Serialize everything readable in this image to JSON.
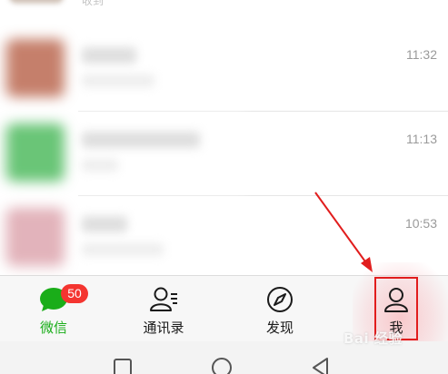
{
  "top_partial": {
    "text": "收到"
  },
  "chats": [
    {
      "time": "11:32",
      "avatar_color": "#b2553a"
    },
    {
      "time": "11:13",
      "avatar_color": "#38b24a"
    },
    {
      "time": "10:53",
      "avatar_color": "#d99aa4"
    }
  ],
  "tabbar": {
    "tabs": [
      {
        "label": "微信",
        "icon": "chat-bubble-icon",
        "badge": "50",
        "active": true
      },
      {
        "label": "通讯录",
        "icon": "contacts-icon",
        "active": false
      },
      {
        "label": "发现",
        "icon": "compass-icon",
        "active": false
      },
      {
        "label": "我",
        "icon": "person-icon",
        "active": false
      }
    ]
  },
  "annotation": {
    "arrow_color": "#e11d1d",
    "box_color": "#e11d1d"
  },
  "navbar": {
    "buttons": [
      "recent-apps-icon",
      "home-icon",
      "back-icon"
    ]
  },
  "watermark": {
    "text": "Bai 经验"
  },
  "colors": {
    "accent_green": "#1aad19",
    "badge_red": "#f43530"
  }
}
